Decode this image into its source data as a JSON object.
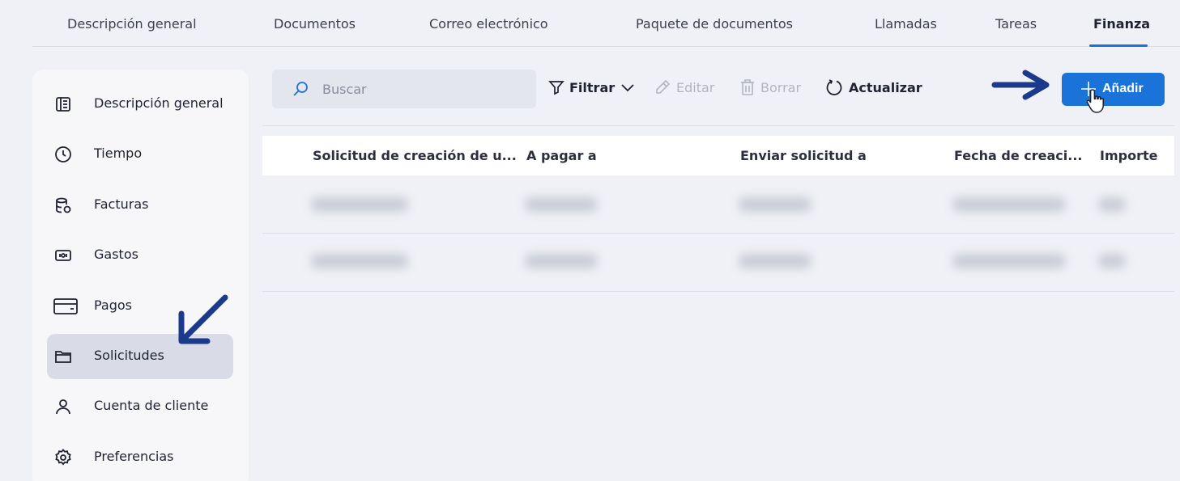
{
  "tabs": [
    {
      "label": "Descripción general",
      "active": false
    },
    {
      "label": "Documentos",
      "active": false
    },
    {
      "label": "Correo electrónico",
      "active": false
    },
    {
      "label": "Paquete de documentos",
      "active": false
    },
    {
      "label": "Llamadas",
      "active": false
    },
    {
      "label": "Tareas",
      "active": false
    },
    {
      "label": "Finanza",
      "active": true
    }
  ],
  "sidebar": {
    "items": [
      {
        "label": "Descripción general",
        "icon": "overview-icon"
      },
      {
        "label": "Tiempo",
        "icon": "clock-icon"
      },
      {
        "label": "Facturas",
        "icon": "invoices-icon"
      },
      {
        "label": "Gastos",
        "icon": "expenses-icon"
      },
      {
        "label": "Pagos",
        "icon": "payments-icon"
      },
      {
        "label": "Solicitudes",
        "icon": "folder-icon",
        "active": true
      },
      {
        "label": "Cuenta de cliente",
        "icon": "user-icon"
      },
      {
        "label": "Preferencias",
        "icon": "gear-icon"
      }
    ]
  },
  "toolbar": {
    "search_placeholder": "Buscar",
    "filter_label": "Filtrar",
    "edit_label": "Editar",
    "delete_label": "Borrar",
    "refresh_label": "Actualizar",
    "add_label": "Añadir"
  },
  "table": {
    "columns": [
      "Solicitud de creación de u...",
      "A pagar a",
      "Enviar solicitud a",
      "Fecha de creaci...",
      "Importe"
    ]
  },
  "colors": {
    "accent": "#1a73d9",
    "annotation_arrow": "#1b3a8c",
    "active_item_bg": "#d9dbe6"
  }
}
